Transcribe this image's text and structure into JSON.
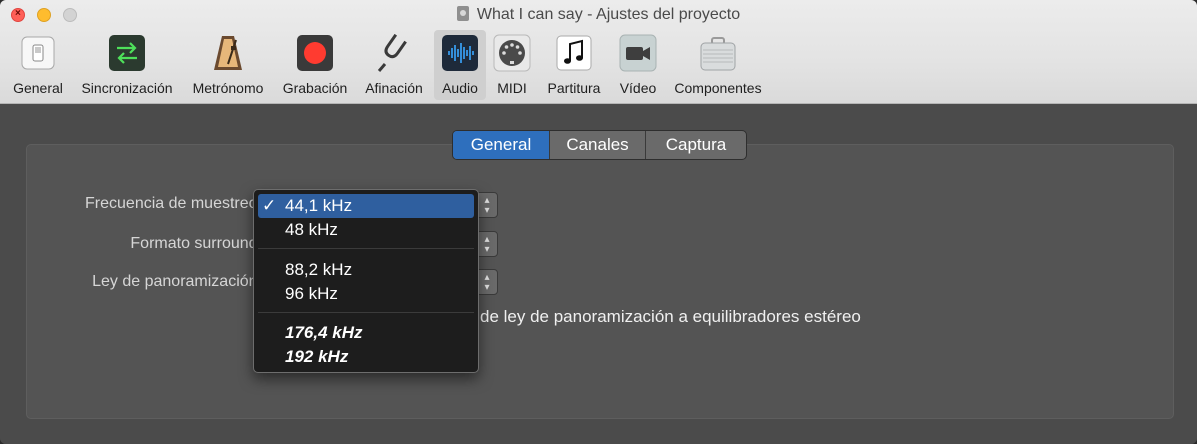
{
  "window": {
    "title": "What I can say - Ajustes del proyecto"
  },
  "toolbar": {
    "items": [
      {
        "label": "General",
        "icon": "switch-icon"
      },
      {
        "label": "Sincronización",
        "icon": "sync-arrows-icon"
      },
      {
        "label": "Metrónomo",
        "icon": "metronome-icon"
      },
      {
        "label": "Grabación",
        "icon": "record-icon"
      },
      {
        "label": "Afinación",
        "icon": "tuning-fork-icon"
      },
      {
        "label": "Audio",
        "icon": "audio-waveform-icon",
        "active": true
      },
      {
        "label": "MIDI",
        "icon": "midi-connector-icon"
      },
      {
        "label": "Partitura",
        "icon": "music-note-icon"
      },
      {
        "label": "Vídeo",
        "icon": "video-camera-icon"
      },
      {
        "label": "Componentes",
        "icon": "briefcase-icon"
      }
    ]
  },
  "tabs": [
    {
      "label": "General",
      "active": true
    },
    {
      "label": "Canales",
      "active": false
    },
    {
      "label": "Captura",
      "active": false
    }
  ],
  "form": {
    "sample_rate_label": "Frecuencia de muestreo:",
    "surround_label": "Formato surround:",
    "pan_law_label": "Ley de panoramización:",
    "apply_pan_law_text": "de ley de panoramización a equilibradores estéreo"
  },
  "sample_rate_menu": {
    "check": "✓",
    "groups": [
      [
        "44,1 kHz",
        "48 kHz"
      ],
      [
        "88,2 kHz",
        "96 kHz"
      ],
      [
        "176,4 kHz",
        "192 kHz"
      ]
    ],
    "selected": "44,1 kHz"
  },
  "colors": {
    "accent": "#2e6fbd",
    "menu_highlight": "#2f5f9f",
    "record_red": "#ff3b30"
  }
}
